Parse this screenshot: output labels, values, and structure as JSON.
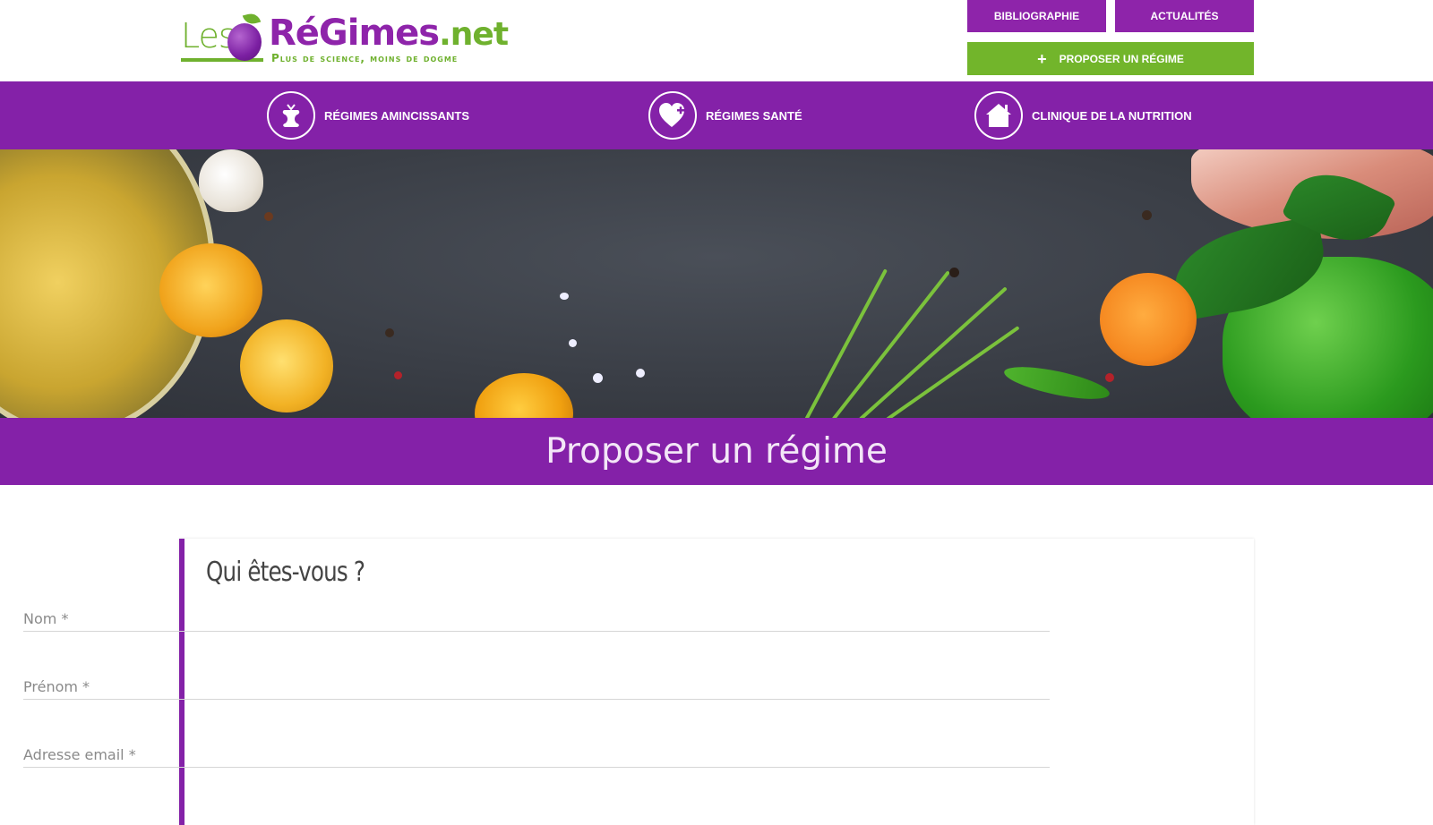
{
  "header": {
    "logo": {
      "les": "Les",
      "brand": "RéGimes",
      "tld": ".net",
      "tagline": "Plus de science, moins de dogme"
    },
    "top_buttons": [
      {
        "label": "Bibliographie"
      },
      {
        "label": "Actualités"
      }
    ],
    "propose_button": {
      "icon": "plus-icon",
      "label": "Proposer un régime"
    }
  },
  "nav": {
    "items": [
      {
        "icon": "apple-core-icon",
        "label": "Régimes amincissants"
      },
      {
        "icon": "heart-plus-icon",
        "label": "Régimes santé"
      },
      {
        "icon": "house-icon",
        "label": "Clinique de la nutrition"
      }
    ]
  },
  "page": {
    "title": "Proposer un régime"
  },
  "form": {
    "section_title": "Qui êtes-vous ?",
    "fields": [
      {
        "label": "Nom",
        "required": "*"
      },
      {
        "label": "Prénom",
        "required": "*"
      },
      {
        "label": "Adresse email",
        "required": "*"
      }
    ]
  },
  "colors": {
    "purple": "#8421a8",
    "green": "#72b52b",
    "title_text": "#f3e6f7"
  }
}
